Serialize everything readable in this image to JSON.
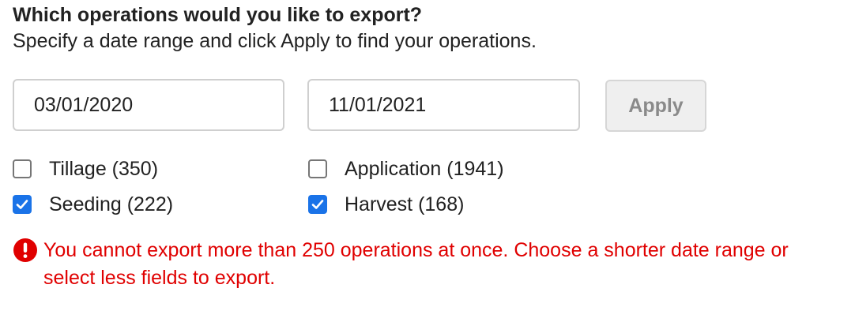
{
  "prompt": {
    "title": "Which operations would you like to export?",
    "subtitle": "Specify a date range and click Apply to find your operations."
  },
  "date_range": {
    "start": "03/01/2020",
    "end": "11/01/2021",
    "apply_label": "Apply"
  },
  "operations": [
    {
      "label": "Tillage (350)",
      "checked": false
    },
    {
      "label": "Application (1941)",
      "checked": false
    },
    {
      "label": "Seeding (222)",
      "checked": true
    },
    {
      "label": "Harvest (168)",
      "checked": true
    }
  ],
  "error": {
    "icon": "exclamation-circle-icon",
    "message": "You cannot export more than 250 operations at once. Choose a shorter date range or select less fields to export."
  },
  "colors": {
    "checkbox_checked": "#1a73e8",
    "error": "#e00000",
    "apply_disabled_text": "#8a8a8a"
  }
}
